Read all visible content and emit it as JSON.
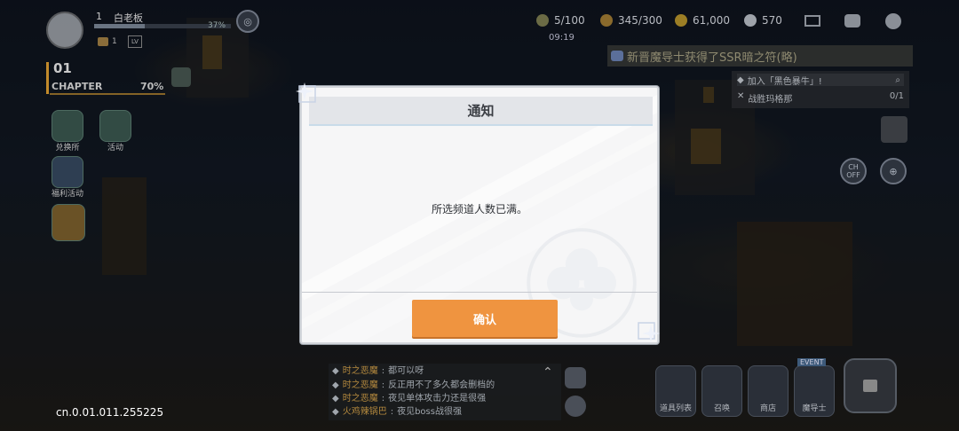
{
  "player": {
    "level": "1",
    "name": "白老板",
    "exp": "37%",
    "rank_num": "1",
    "lv_badge": "LV"
  },
  "chapter": {
    "number": "01",
    "label": "CHAPTER",
    "percent": "70%"
  },
  "resources": {
    "stamina": "5/100",
    "second": "345/300",
    "gold": "61,000",
    "gems": "570",
    "timer": "09:19"
  },
  "broadcast": {
    "text": "新晋魔导士获得了SSR暗之符(略)",
    "prefix": "新晋魔导士",
    "mid": "获得了"
  },
  "quest": {
    "title": "加入「黑色暴牛」!",
    "task": "战胜玛格那",
    "count": "0/1"
  },
  "side_menu": {
    "exchange": "兑换所",
    "event": "活动",
    "welfare": "福利活动"
  },
  "chat": {
    "lines": [
      {
        "name": "时之恶魔",
        "text": "都可以呀"
      },
      {
        "name": "时之恶魔",
        "text": "反正用不了多久都会删档的"
      },
      {
        "name": "时之恶魔",
        "text": "夜见单体攻击力还是很强"
      },
      {
        "name": "火鸡辣锅巴",
        "text": "夜见boss战很强"
      }
    ]
  },
  "bottom_nav": {
    "equipment": "道具列表",
    "summon": "召唤",
    "shop": "商店",
    "mage": "魔导士",
    "event_badge": "EVENT"
  },
  "ch_toggle": "CH\nOFF",
  "version": "cn.0.01.011.255225",
  "dialog": {
    "title": "通知",
    "message": "所选频道人数已满。",
    "confirm_label": "确认"
  },
  "colors": {
    "confirm": "#ef9440",
    "dialog_bg": "#f6f6f7"
  }
}
